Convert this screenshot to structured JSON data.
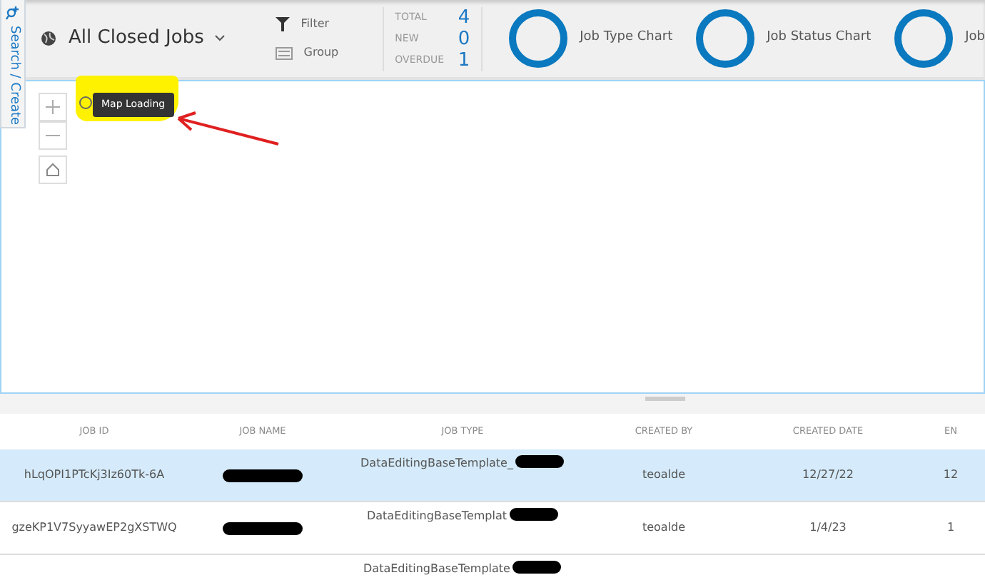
{
  "side_tab": {
    "label": "Search / Create"
  },
  "query": {
    "title": "All Closed Jobs"
  },
  "tools": [
    {
      "kind": "filter",
      "label": "Filter"
    },
    {
      "kind": "group",
      "label": "Group"
    }
  ],
  "stats": [
    {
      "label": "TOTAL",
      "value": "4"
    },
    {
      "label": "NEW",
      "value": "0"
    },
    {
      "label": "OVERDUE",
      "value": "1"
    }
  ],
  "charts": [
    {
      "label": "Job Type Chart"
    },
    {
      "label": "Job Status Chart"
    },
    {
      "label": "Job"
    }
  ],
  "map": {
    "tooltip": "Map Loading"
  },
  "table": {
    "columns": [
      "JOB ID",
      "JOB NAME",
      "JOB TYPE",
      "CREATED BY",
      "CREATED DATE",
      "EN"
    ],
    "rows": [
      {
        "selected": true,
        "cells": [
          "hLqOPI1PTcKj3Iz60Tk-6A",
          "",
          "DataEditingBaseTemplate_",
          "teoalde",
          "12/27/22",
          "12"
        ]
      },
      {
        "selected": false,
        "cells": [
          "gzeKP1V7SyyawEP2gXSTWQ",
          "",
          "DataEditingBaseTemplat",
          "teoalde",
          "1/4/23",
          "1"
        ]
      },
      {
        "selected": false,
        "cells": [
          "",
          "",
          "DataEditingBaseTemplate",
          "",
          "",
          ""
        ]
      }
    ]
  }
}
